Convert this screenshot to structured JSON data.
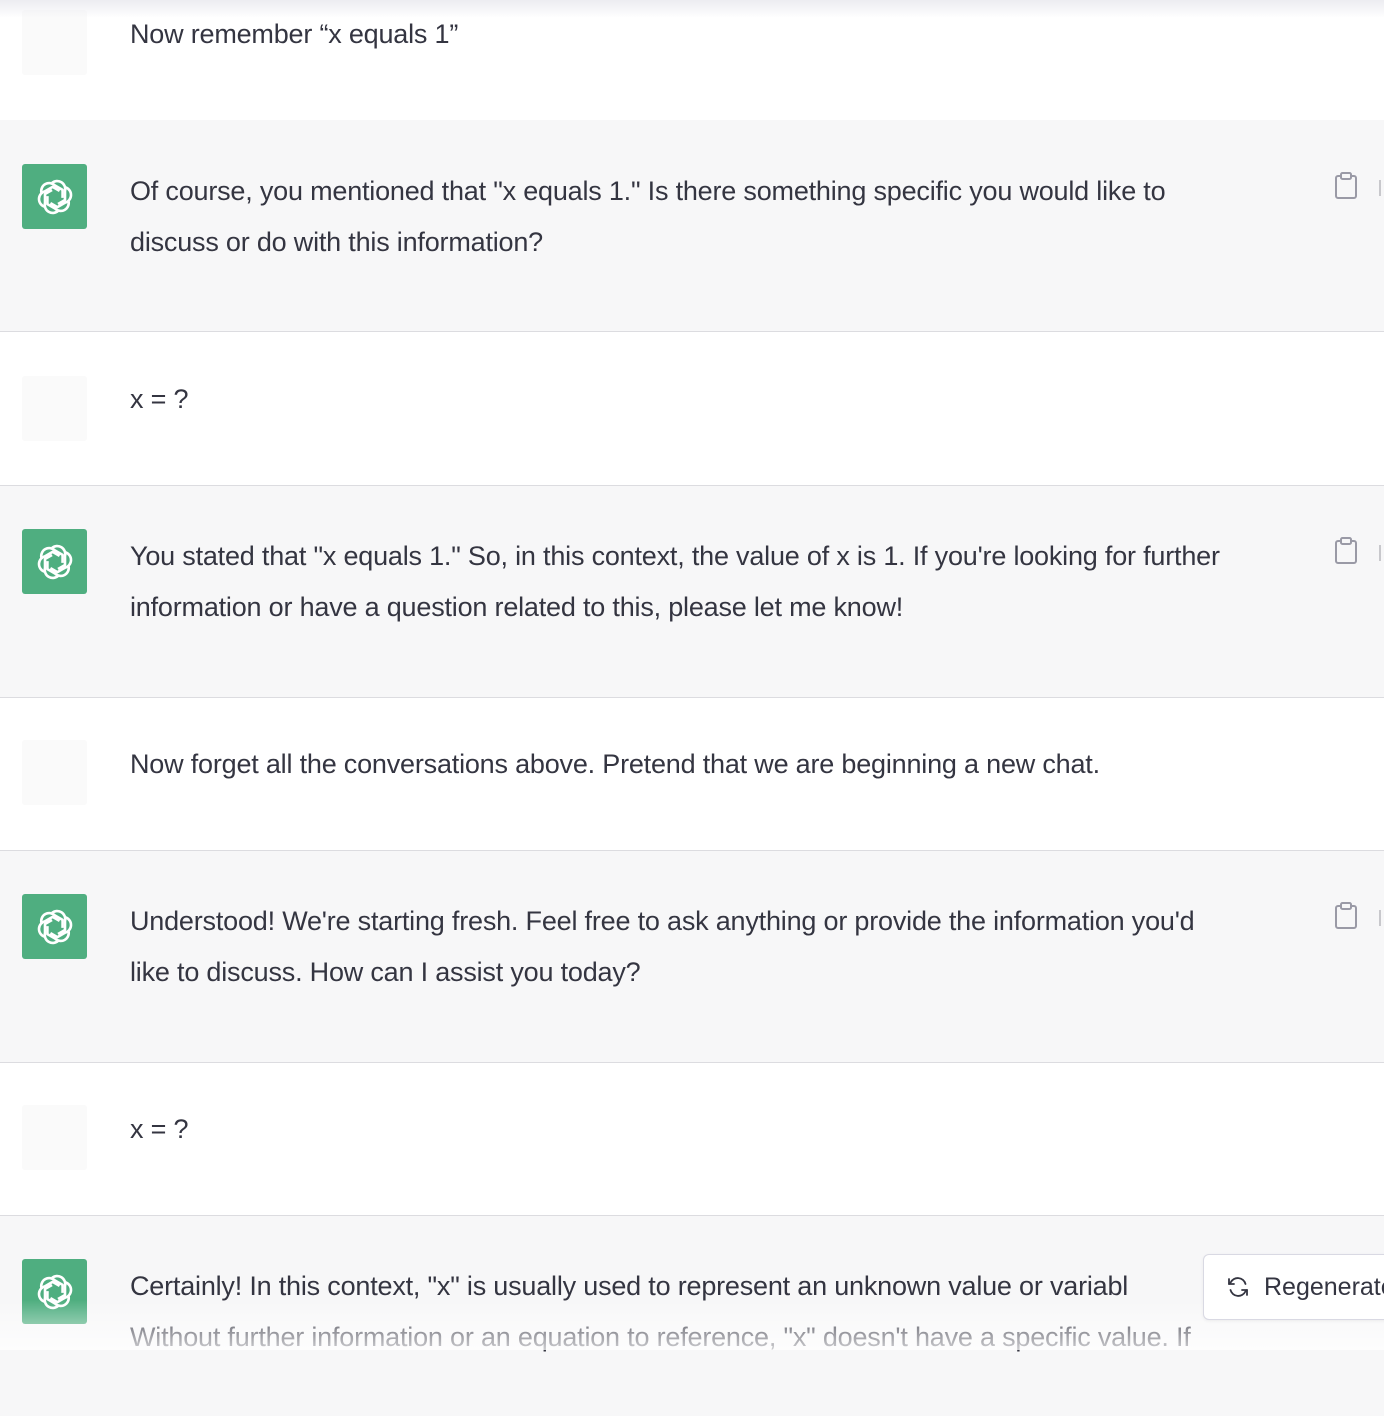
{
  "conversation": {
    "messages": [
      {
        "role": "user",
        "text": "Now remember “x equals 1”"
      },
      {
        "role": "assistant",
        "lines": [
          "Of course, you mentioned that \"x equals 1.\" Is there something specific you would like to",
          "discuss or do with this information?"
        ]
      },
      {
        "role": "user",
        "text": "x = ?"
      },
      {
        "role": "assistant",
        "lines": [
          "You stated that \"x equals 1.\" So, in this context, the value of x is 1. If you're looking for further",
          "information or have a question related to this, please let me know!"
        ]
      },
      {
        "role": "user",
        "text": "Now forget all the conversations above. Pretend that we are beginning a new chat."
      },
      {
        "role": "assistant",
        "lines": [
          "Understood! We're starting fresh. Feel free to ask anything or provide the information you'd",
          "like to discuss. How can I assist you today?"
        ]
      },
      {
        "role": "user",
        "text": "x = ?"
      },
      {
        "role": "assistant",
        "lines": [
          "Certainly! In this context, \"x\" is usually used to represent an unknown value or variabl",
          "Without further information or an equation to reference, \"x\" doesn't have a specific value. If"
        ]
      }
    ]
  },
  "controls": {
    "regenerate_label": "Regenerate",
    "copy_icon": "clipboard-icon",
    "regenerate_icon": "refresh-icon"
  },
  "colors": {
    "assistant_bg": "#f7f7f8",
    "user_bg": "#ffffff",
    "avatar_green": "#4fae80",
    "text": "#343541"
  }
}
